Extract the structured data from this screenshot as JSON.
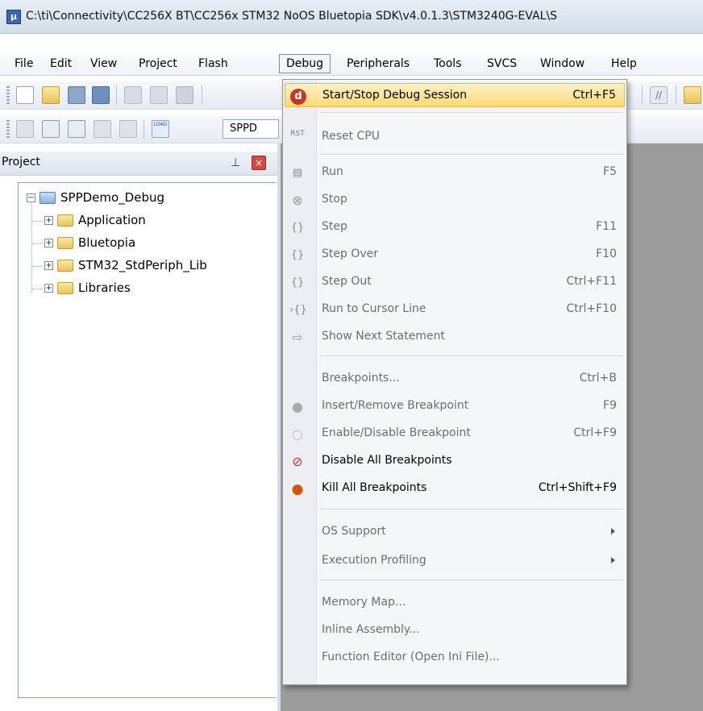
{
  "window": {
    "title": "C:\\ti\\Connectivity\\CC256X BT\\CC256x STM32 NoOS Bluetopia SDK\\v4.0.1.3\\STM3240G-EVAL\\S"
  },
  "menubar": [
    "File",
    "Edit",
    "View",
    "Project",
    "Flash",
    "Debug",
    "Peripherals",
    "Tools",
    "SVCS",
    "Window",
    "Help"
  ],
  "toolbar2": {
    "target_value": "SPPD",
    "load_icon_label": "LOAD"
  },
  "project_panel": {
    "title": "Project",
    "tree": {
      "root": "SPPDemo_Debug",
      "children": [
        "Application",
        "Bluetopia",
        "STM32_StdPeriph_Lib",
        "Libraries"
      ]
    }
  },
  "debug_menu": {
    "items": [
      {
        "label": "Start/Stop Debug Session",
        "shortcut": "Ctrl+F5",
        "icon": "debug-session-icon",
        "enabled": true,
        "highlighted": true
      },
      {
        "label": "Reset CPU",
        "shortcut": "",
        "icon": "reset-cpu-icon",
        "enabled": false
      },
      {
        "label": "Run",
        "shortcut": "F5",
        "icon": "run-icon",
        "enabled": false
      },
      {
        "label": "Stop",
        "shortcut": "",
        "icon": "stop-icon",
        "enabled": false
      },
      {
        "label": "Step",
        "shortcut": "F11",
        "icon": "step-icon",
        "enabled": false
      },
      {
        "label": "Step Over",
        "shortcut": "F10",
        "icon": "step-over-icon",
        "enabled": false
      },
      {
        "label": "Step Out",
        "shortcut": "Ctrl+F11",
        "icon": "step-out-icon",
        "enabled": false
      },
      {
        "label": "Run to Cursor Line",
        "shortcut": "Ctrl+F10",
        "icon": "run-to-cursor-icon",
        "enabled": false
      },
      {
        "label": "Show Next Statement",
        "shortcut": "",
        "icon": "show-next-statement-icon",
        "enabled": false
      },
      {
        "label": "Breakpoints...",
        "shortcut": "Ctrl+B",
        "icon": "",
        "enabled": false
      },
      {
        "label": "Insert/Remove Breakpoint",
        "shortcut": "F9",
        "icon": "insert-breakpoint-icon",
        "enabled": false
      },
      {
        "label": "Enable/Disable Breakpoint",
        "shortcut": "Ctrl+F9",
        "icon": "enable-breakpoint-icon",
        "enabled": false
      },
      {
        "label": "Disable All Breakpoints",
        "shortcut": "",
        "icon": "disable-all-breakpoints-icon",
        "enabled": true
      },
      {
        "label": "Kill All Breakpoints",
        "shortcut": "Ctrl+Shift+F9",
        "icon": "kill-all-breakpoints-icon",
        "enabled": true
      },
      {
        "label": "OS Support",
        "shortcut": "",
        "icon": "",
        "enabled": false,
        "submenu": true
      },
      {
        "label": "Execution Profiling",
        "shortcut": "",
        "icon": "",
        "enabled": false,
        "submenu": true
      },
      {
        "label": "Memory Map...",
        "shortcut": "",
        "icon": "",
        "enabled": false
      },
      {
        "label": "Inline Assembly...",
        "shortcut": "",
        "icon": "",
        "enabled": false
      },
      {
        "label": "Function Editor (Open Ini File)...",
        "shortcut": "",
        "icon": "",
        "enabled": false
      }
    ]
  },
  "colors": {
    "highlight": "#fcd978",
    "workspace": "#9c9c9c",
    "menu_bg": "#f5f6f8"
  }
}
